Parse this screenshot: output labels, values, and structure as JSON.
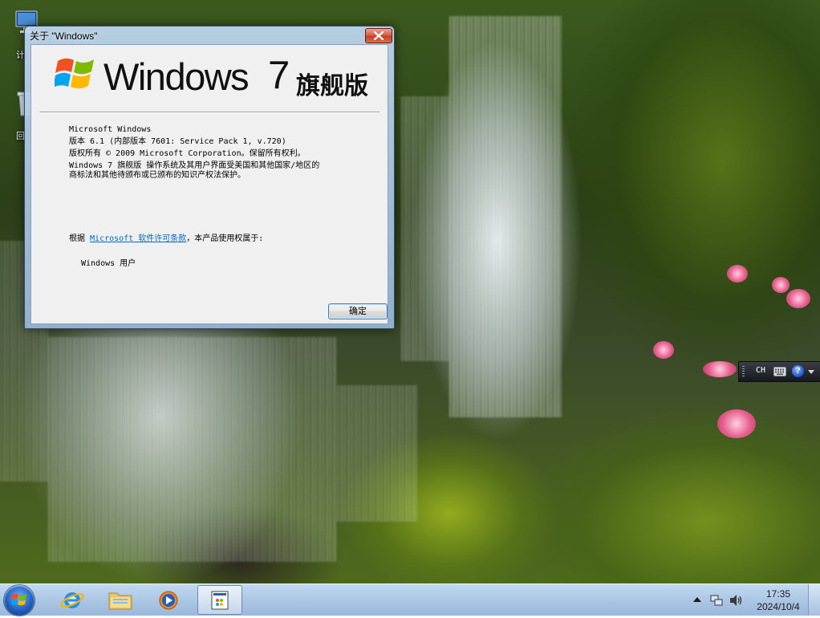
{
  "desktop": {
    "icons": [
      {
        "label": "计",
        "icon": "computer-icon"
      },
      {
        "label": "回",
        "icon": "recycle-bin-icon"
      }
    ]
  },
  "about_dialog": {
    "title": "关于 \"Windows\"",
    "brand": {
      "windows": "Windows",
      "version_number": "7",
      "edition": "旗舰版"
    },
    "info_lines": [
      "Microsoft Windows",
      "版本 6.1 (内部版本 7601: Service Pack 1, v.720)",
      "版权所有 © 2009 Microsoft Corporation。保留所有权利。",
      "Windows 7 旗舰版 操作系统及其用户界面受美国和其他国家/地区的",
      "商标法和其他待颁布或已颁布的知识产权法保护。"
    ],
    "license_prefix": "根据 ",
    "license_link": "Microsoft 软件许可条款",
    "license_suffix": "，本产品使用权属于:",
    "licensee": "Windows 用户",
    "ok_label": "确定"
  },
  "language_bar": {
    "language": "CH",
    "icons": [
      "keyboard-icon",
      "help-icon"
    ],
    "help_label": "?"
  },
  "taskbar": {
    "pinned": [
      "internet-explorer-icon",
      "windows-explorer-icon",
      "media-player-icon"
    ],
    "running": [
      "about-windows-app-icon"
    ],
    "tray": [
      "tray-overflow-chevron-icon",
      "network-icon",
      "volume-icon"
    ],
    "clock_time": "17:35",
    "clock_date": "2024/10/4"
  },
  "colors": {
    "link": "#0066cc",
    "close_button": "#c24128",
    "taskbar": "#a8c4e2"
  }
}
